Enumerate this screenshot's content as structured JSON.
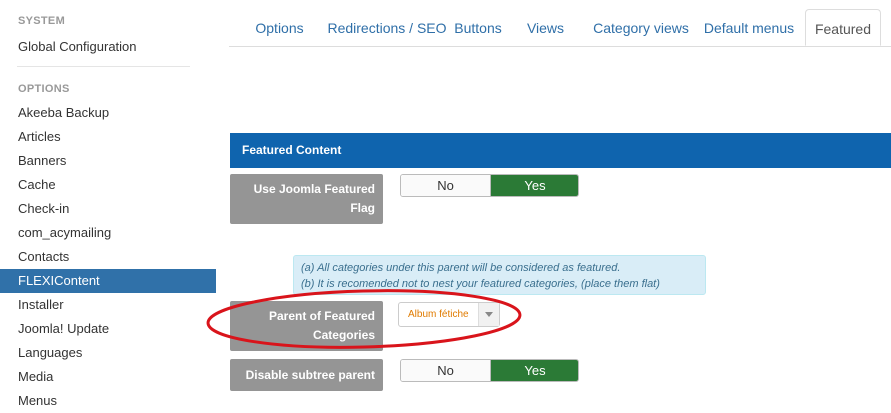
{
  "sidebar": {
    "system_heading": "SYSTEM",
    "global_config": "Global Configuration",
    "options_heading": "OPTIONS",
    "items": [
      {
        "label": "Akeeba Backup"
      },
      {
        "label": "Articles"
      },
      {
        "label": "Banners"
      },
      {
        "label": "Cache"
      },
      {
        "label": "Check-in"
      },
      {
        "label": "com_acymailing"
      },
      {
        "label": "Contacts"
      },
      {
        "label": "FLEXIContent",
        "active": true
      },
      {
        "label": "Installer"
      },
      {
        "label": "Joomla! Update"
      },
      {
        "label": "Languages"
      },
      {
        "label": "Media"
      },
      {
        "label": "Menus"
      }
    ]
  },
  "tabs": [
    {
      "label": "Options"
    },
    {
      "label": "Redirections / SEO"
    },
    {
      "label": "Buttons"
    },
    {
      "label": "Views"
    },
    {
      "label": "Category views"
    },
    {
      "label": "Default menus"
    },
    {
      "label": "Featured",
      "active": true
    }
  ],
  "panel": {
    "title": "Featured Content",
    "use_flag": {
      "label": "Use Joomla Featured Flag",
      "no": "No",
      "yes": "Yes",
      "selected": "Yes"
    },
    "info_lines": [
      "(a) All categories under this parent will be considered as featured.",
      "(b) It is recomended not to nest your featured categories, (place them flat)"
    ],
    "parent": {
      "label": "Parent of Featured Categories",
      "value": "Album fétiche"
    },
    "disable_subtree": {
      "label": "Disable subtree parent",
      "no": "No",
      "yes": "Yes",
      "selected": "Yes"
    }
  },
  "colors": {
    "active_sidebar": "#3071a9",
    "panel_header": "#0f64ae",
    "toggle_yes": "#2b7a36",
    "annotation_ellipse": "#d9141b"
  }
}
